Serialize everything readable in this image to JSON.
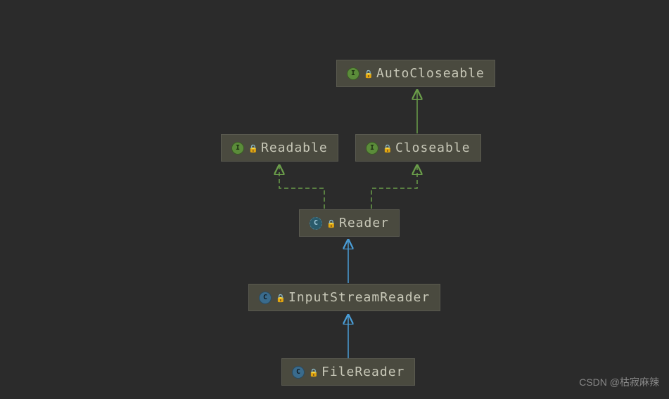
{
  "nodes": {
    "autocloseable": {
      "label": "AutoCloseable",
      "type": "interface",
      "type_char": "I"
    },
    "readable": {
      "label": "Readable",
      "type": "interface",
      "type_char": "I"
    },
    "closeable": {
      "label": "Closeable",
      "type": "interface",
      "type_char": "I"
    },
    "reader": {
      "label": "Reader",
      "type": "abstract",
      "type_char": "C"
    },
    "inputstreamreader": {
      "label": "InputStreamReader",
      "type": "class",
      "type_char": "C"
    },
    "filereader": {
      "label": "FileReader",
      "type": "class",
      "type_char": "C"
    }
  },
  "edges": [
    {
      "from": "closeable",
      "to": "autocloseable",
      "style": "solid",
      "color": "#6b9e4a"
    },
    {
      "from": "reader",
      "to": "readable",
      "style": "dashed",
      "color": "#6b9e4a"
    },
    {
      "from": "reader",
      "to": "closeable",
      "style": "dashed",
      "color": "#6b9e4a"
    },
    {
      "from": "inputstreamreader",
      "to": "reader",
      "style": "solid",
      "color": "#4a9ed8"
    },
    {
      "from": "filereader",
      "to": "inputstreamreader",
      "style": "solid",
      "color": "#4a9ed8"
    }
  ],
  "watermark": "CSDN @枯寂麻辣"
}
